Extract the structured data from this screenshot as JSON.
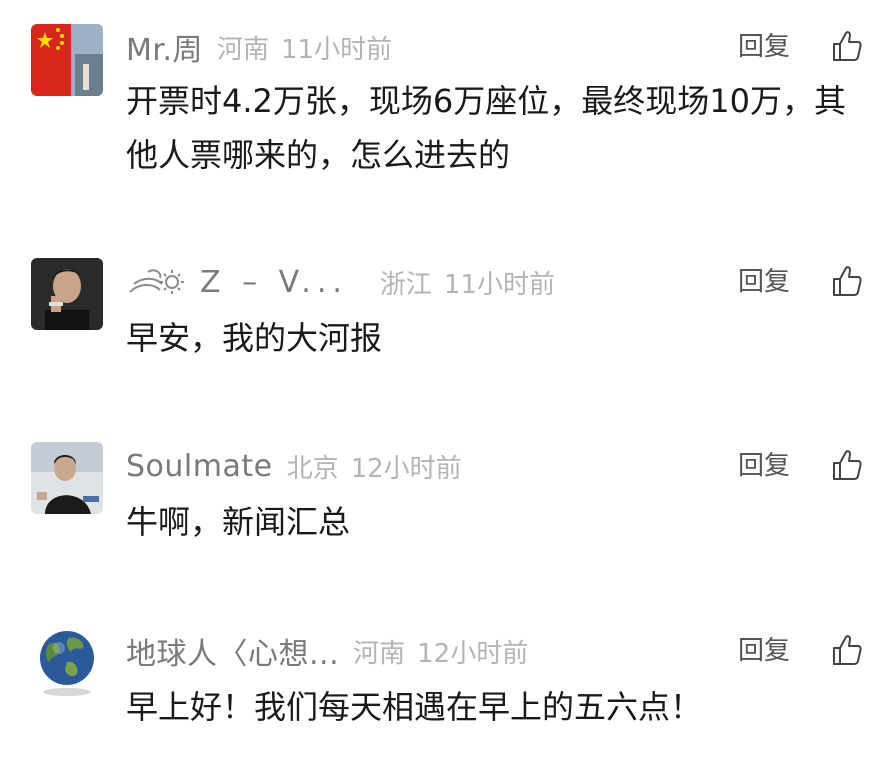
{
  "colors": {
    "nickname": "#7a7a7a",
    "meta": "#b4b4b4",
    "text": "#1a1a1a",
    "reply": "#555555"
  },
  "comments": [
    {
      "nickname": "Mr.周",
      "location": "河南",
      "time": "11小时前",
      "reply_label": "回复",
      "like_icon": "thumbs-up-icon",
      "text": "开票时4.2万张，现场6万座位，最终现场10万，其他人票哪来的，怎么进去的"
    },
    {
      "nickname": "Z – V...",
      "location": "浙江",
      "time": "11小时前",
      "reply_label": "回复",
      "like_icon": "thumbs-up-icon",
      "text": "早安，我的大河报"
    },
    {
      "nickname": "Soulmate",
      "location": "北京",
      "time": "12小时前",
      "reply_label": "回复",
      "like_icon": "thumbs-up-icon",
      "text": "牛啊，新闻汇总"
    },
    {
      "nickname": "地球人〈心想...",
      "location": "河南",
      "time": "12小时前",
      "reply_label": "回复",
      "like_icon": "thumbs-up-icon",
      "text": "早上好！我们每天相遇在早上的五六点！"
    }
  ]
}
